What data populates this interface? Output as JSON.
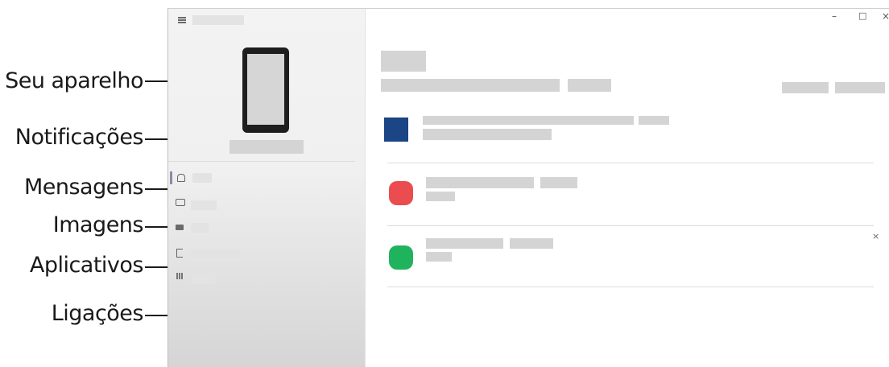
{
  "callouts": {
    "device": "Seu aparelho",
    "notifications": "Notificações",
    "messages": "Mensagens",
    "images": "Imagens",
    "apps": "Aplicativos",
    "calls": "Ligações"
  },
  "window_controls": {
    "minimize": "–",
    "maximize": "□",
    "close": "×"
  },
  "notification_close": "×",
  "colors": {
    "app_blue": "#1b4585",
    "app_red": "#ea4c4f",
    "app_green": "#20b35d"
  }
}
